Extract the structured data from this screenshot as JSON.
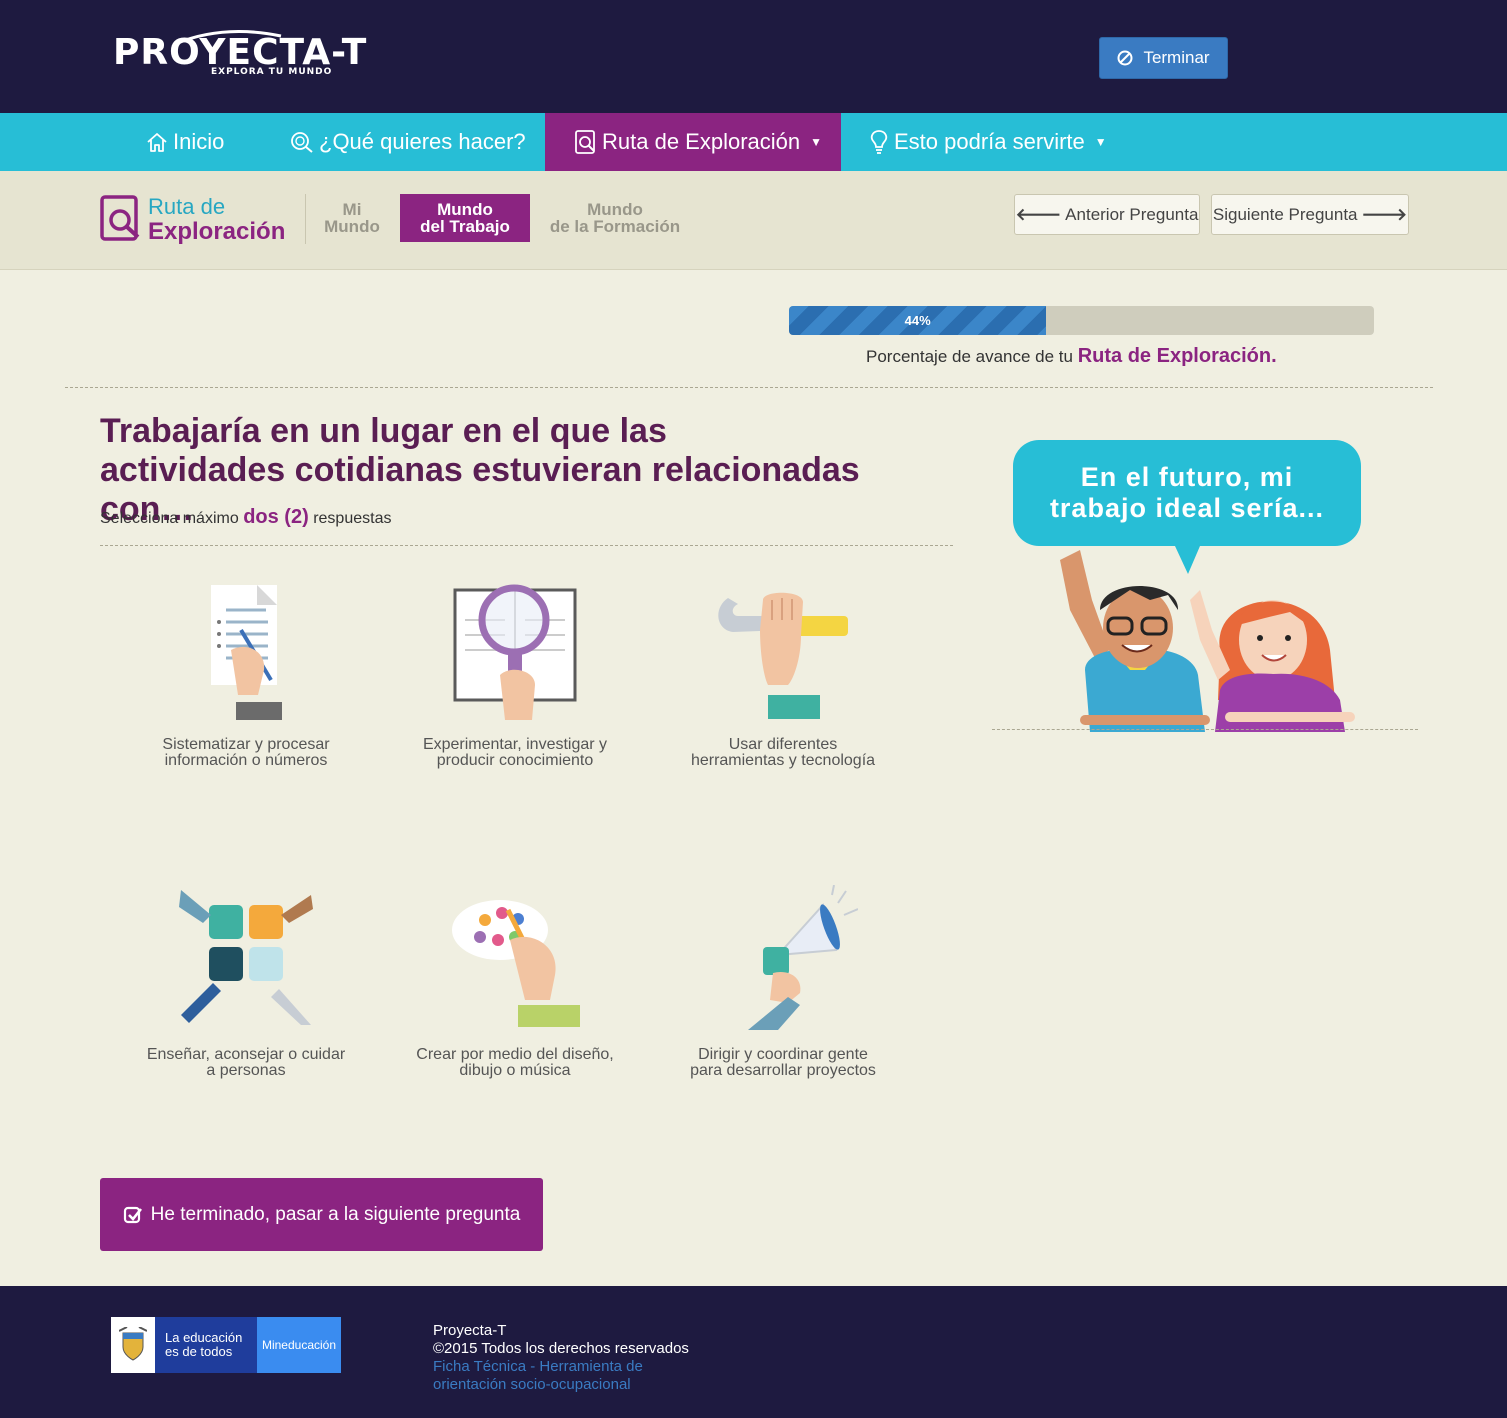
{
  "header": {
    "logo_text": "PROYECTA-T",
    "logo_tagline": "EXPLORA TU MUNDO",
    "terminar_label": "Terminar"
  },
  "nav": {
    "items": [
      {
        "label": "Inicio",
        "icon": "home-icon"
      },
      {
        "label": "¿Qué quieres hacer?",
        "icon": "search-icon"
      },
      {
        "label": "Ruta de Exploración",
        "icon": "magnifier-page-icon",
        "active": true,
        "dropdown": true
      },
      {
        "label": "Esto podría servirte",
        "icon": "lightbulb-icon",
        "dropdown": true
      }
    ]
  },
  "subheader": {
    "ruta_line1": "Ruta de",
    "ruta_line2": "Exploración",
    "worlds": [
      {
        "line1": "Mi",
        "line2": "Mundo"
      },
      {
        "line1": "Mundo",
        "line2": "del Trabajo",
        "active": true
      },
      {
        "line1": "Mundo",
        "line2": "de la Formación"
      }
    ],
    "prev_label": "Anterior Pregunta",
    "next_label": "Siguiente Pregunta"
  },
  "progress": {
    "value": 44,
    "label": "44%",
    "caption": "Porcentaje de avance de tu",
    "caption_bold": "Ruta de Exploración."
  },
  "question": {
    "title": "Trabajaría en un lugar en el que las actividades cotidianas estuvieran relacionadas con…",
    "hint_pre": "Selecciona máximo",
    "hint_bold": "dos (2)",
    "hint_post": "respuestas",
    "options": [
      {
        "line1": "Sistematizar y procesar",
        "line2": "información o números"
      },
      {
        "line1": "Experimentar, investigar y",
        "line2": "producir conocimiento"
      },
      {
        "line1": "Usar diferentes",
        "line2": "herramientas y tecnología"
      },
      {
        "line1": "Enseñar, aconsejar o cuidar",
        "line2": "a personas"
      },
      {
        "line1": "Crear por medio del diseño,",
        "line2": "dibujo o música"
      },
      {
        "line1": "Dirigir y coordinar gente",
        "line2": "para desarrollar proyectos"
      }
    ]
  },
  "speech": {
    "line1": "En el futuro, mi",
    "line2": "trabajo ideal sería..."
  },
  "finish_button": "He terminado, pasar a la siguiente pregunta",
  "footer": {
    "gov_line1": "La educación",
    "gov_line2": "es de todos",
    "gov_ministry": "Mineducación",
    "line1": "Proyecta-T",
    "line2": "©2015 Todos los derechos reservados",
    "link_line1": "Ficha Técnica - Herramienta de",
    "link_line2": "orientación socio-ocupacional"
  },
  "colors": {
    "header_bg": "#1e1a40",
    "nav_bg": "#27bed6",
    "accent_purple": "#8b2481",
    "page_bg": "#f0efe1",
    "button_blue": "#3a7bc2"
  }
}
